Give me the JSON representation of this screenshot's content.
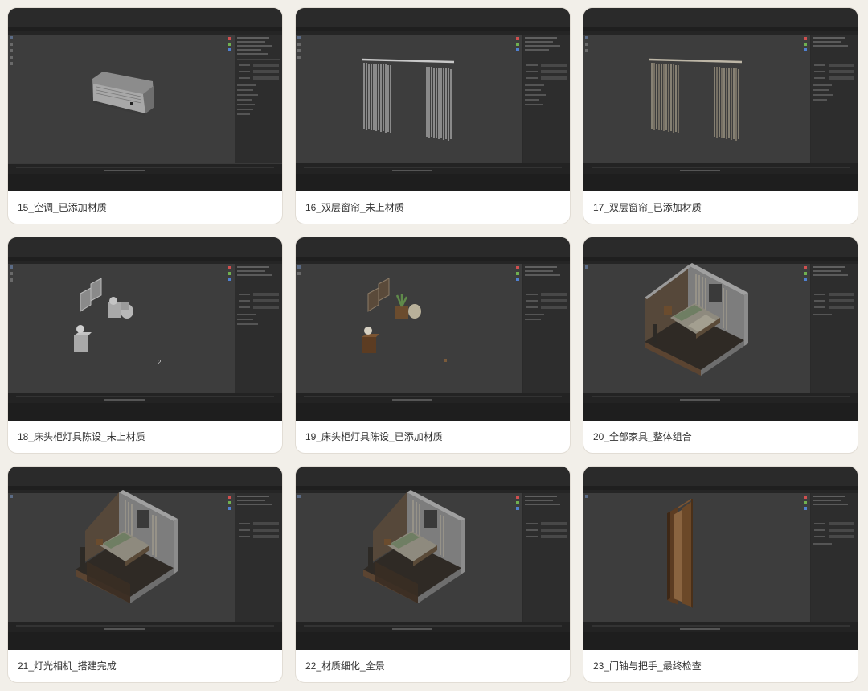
{
  "cards": [
    {
      "label": "15_空调_已添加材质"
    },
    {
      "label": "16_双层窗帘_未上材质"
    },
    {
      "label": "17_双层窗帘_已添加材质"
    },
    {
      "label": "18_床头柜灯具陈设_未上材质"
    },
    {
      "label": "19_床头柜灯具陈设_已添加材质"
    },
    {
      "label": "20_全部家具_整体组合"
    },
    {
      "label": "21_灯光相机_搭建完成"
    },
    {
      "label": "22_材质细化_全景"
    },
    {
      "label": "23_门轴与把手_最终检查"
    }
  ],
  "viewport_overlay_text": "2",
  "colors": {
    "page_bg": "#f2efe9",
    "card_bg": "#ffffff",
    "viewport": "#3d3d3d",
    "ui_dark": "#232323",
    "panel": "#2d2d2d"
  }
}
